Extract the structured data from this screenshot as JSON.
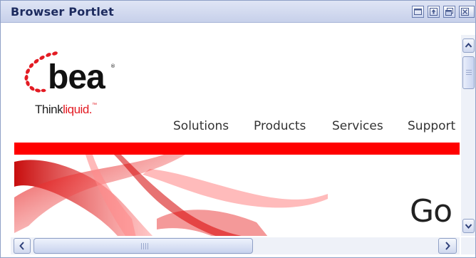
{
  "portlet": {
    "title": "Browser Portlet",
    "controls": [
      {
        "name": "minimize-icon"
      },
      {
        "name": "maximize-icon"
      },
      {
        "name": "restore-icon"
      },
      {
        "name": "close-icon"
      }
    ]
  },
  "content": {
    "logo": {
      "brand": "bea",
      "tagline_prefix": "Think",
      "tagline_highlight": "liquid.",
      "tagline_mark": "™",
      "registered_mark": "®"
    },
    "nav": {
      "items": [
        "Solutions",
        "Products",
        "Services",
        "Support"
      ]
    },
    "hero": {
      "headline": "Go"
    }
  },
  "scrollbars": {
    "vertical": {
      "up_icon": "chevron-up-icon",
      "down_icon": "chevron-down-icon"
    },
    "horizontal": {
      "left_icon": "chevron-left-icon",
      "right_icon": "chevron-right-icon"
    }
  },
  "colors": {
    "title_bg": "#c7d0ea",
    "title_text": "#1c2a5e",
    "brand_red": "#ff0000",
    "scrollbar_bg": "#eef1f8"
  }
}
